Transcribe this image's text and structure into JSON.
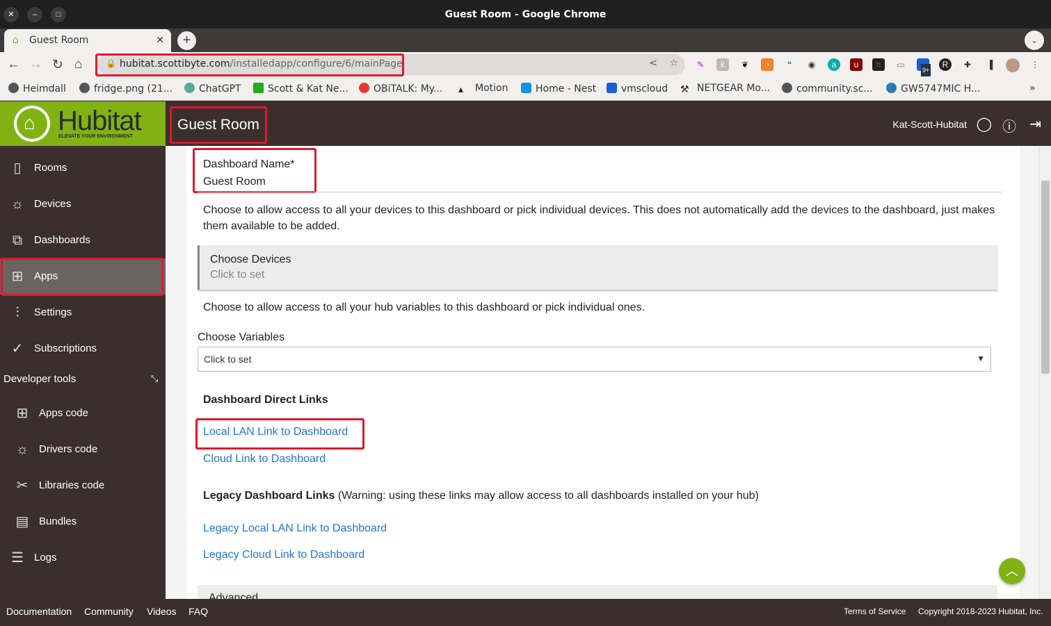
{
  "window": {
    "title": "Guest Room - Google Chrome"
  },
  "tab": {
    "title": "Guest Room"
  },
  "address_bar": {
    "domain": "hubitat.scottibyte.com",
    "path": "/installedapp/configure/6/mainPage"
  },
  "extensions": [
    "pen-icon",
    "k-icon",
    "gnome-icon",
    "rss-icon",
    "hangouts-icon",
    "webcam-icon",
    "a-icon",
    "ublock-icon",
    "h-icon",
    "cast-icon",
    "9+",
    "r-icon",
    "puzzle-icon",
    "sidepanel-icon"
  ],
  "extension_badge": "9+",
  "bookmarks": [
    "Heimdall",
    "fridge.png (21...",
    "ChatGPT",
    "Scott & Kat Ne...",
    "OBiTALK: My...",
    "Motion",
    "Home - Nest",
    "vmscloud",
    "NETGEAR Mo...",
    "community.sc...",
    "GW5747MIC H..."
  ],
  "logo": {
    "text": "Hubitat",
    "tagline": "ELEVATE YOUR ENVIRONMENT",
    "color": "#81b214"
  },
  "header": {
    "title": "Guest Room",
    "hub_name": "Kat-Scott-Hubitat"
  },
  "sidebar": {
    "items": [
      {
        "label": "Rooms",
        "icon": "door-icon"
      },
      {
        "label": "Devices",
        "icon": "bulb-icon"
      },
      {
        "label": "Dashboards",
        "icon": "dashboards-icon"
      },
      {
        "label": "Apps",
        "icon": "apps-icon",
        "active": true
      },
      {
        "label": "Settings",
        "icon": "sliders-icon"
      },
      {
        "label": "Subscriptions",
        "icon": "check-circle-icon"
      }
    ],
    "developer_tools": "Developer tools",
    "dev_items": [
      {
        "label": "Apps code"
      },
      {
        "label": "Drivers code"
      },
      {
        "label": "Libraries code"
      },
      {
        "label": "Bundles"
      },
      {
        "label": "Logs"
      }
    ]
  },
  "main": {
    "dashboard_name_label": "Dashboard Name*",
    "dashboard_name_value": "Guest Room",
    "devices_help": "Choose to allow access to all your devices to this dashboard or pick individual devices. This does not automatically add the devices to the dashboard, just makes them available to be added.",
    "choose_devices": "Choose Devices",
    "click_to_set": "Click to set",
    "variables_help": "Choose to allow access to all your hub variables to this dashboard or pick individual ones.",
    "choose_variables": "Choose Variables",
    "variables_value": "Click to set",
    "direct_links_title": "Dashboard Direct Links",
    "local_link": "Local LAN Link to Dashboard",
    "cloud_link": "Cloud Link to Dashboard",
    "legacy_title": "Legacy Dashboard Links",
    "legacy_warning": " (Warning: using these links may allow access to all dashboards installed on your hub)",
    "legacy_local": "Legacy Local LAN Link to Dashboard",
    "legacy_cloud": "Legacy Cloud Link to Dashboard",
    "advanced": "Advanced"
  },
  "footer": {
    "links": [
      "Documentation",
      "Community",
      "Videos",
      "FAQ"
    ],
    "terms": "Terms of Service",
    "copyright": "Copyright 2018-2023 Hubitat, Inc."
  },
  "colors": {
    "accent": "#81b214",
    "sidebar": "#3a2f2c",
    "link": "#1f76d2",
    "highlight": "#e0182d"
  }
}
